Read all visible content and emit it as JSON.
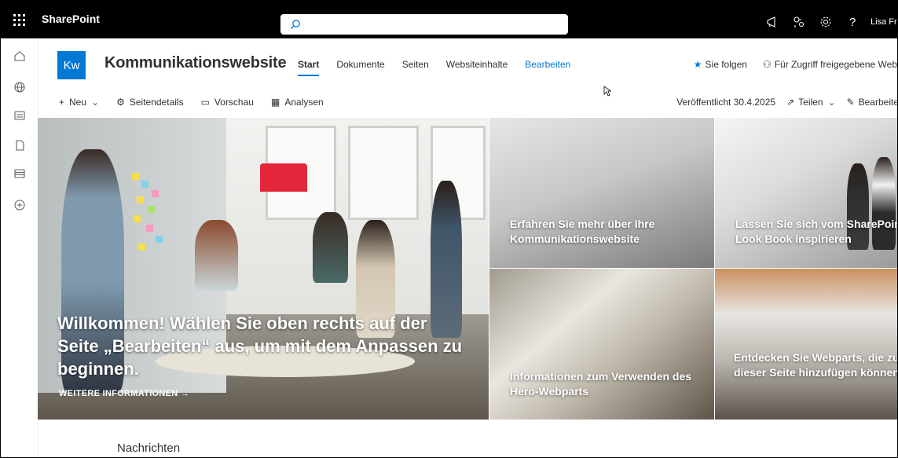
{
  "suitebar": {
    "brand": "SharePoint",
    "user": "Lisa Fr",
    "icons": [
      "megaphone-icon",
      "share-icon",
      "gear-icon",
      "help-icon"
    ]
  },
  "site": {
    "logo": "Kw",
    "title": "Kommunikationswebsite",
    "nav": [
      {
        "label": "Start"
      },
      {
        "label": "Dokumente"
      },
      {
        "label": "Seiten"
      },
      {
        "label": "Websiteinhalte"
      },
      {
        "label": "Bearbeiten"
      }
    ],
    "follow": "Sie folgen",
    "shared": "Für Zugriff freigegebene Web"
  },
  "command": {
    "new": "Neu",
    "details": "Seitendetails",
    "preview": "Vorschau",
    "analytics": "Analysen",
    "published": "Veröffentlicht 30.4.2025",
    "share": "Teilen",
    "edit": "Bearbeite"
  },
  "hero": {
    "main_text": "Willkommen! Wählen Sie oben rechts auf der Seite „Bearbeiten“ aus, um mit dem Anpassen zu beginnen.",
    "main_link": "WEITERE INFORMATIONEN",
    "tiles": [
      {
        "label": "Erfahren Sie mehr über Ihre Kommunikationswebsite"
      },
      {
        "label": "Lassen Sie sich vom SharePoint Look Book inspirieren"
      },
      {
        "label": "Informationen zum Verwenden des Hero-Webparts"
      },
      {
        "label": "Entdecken Sie Webparts, die zu dieser Seite hinzufügen können"
      }
    ]
  },
  "news": {
    "title": "Nachrichten"
  },
  "colors": {
    "accent": "#0078d4",
    "suitebar": "#000000"
  }
}
